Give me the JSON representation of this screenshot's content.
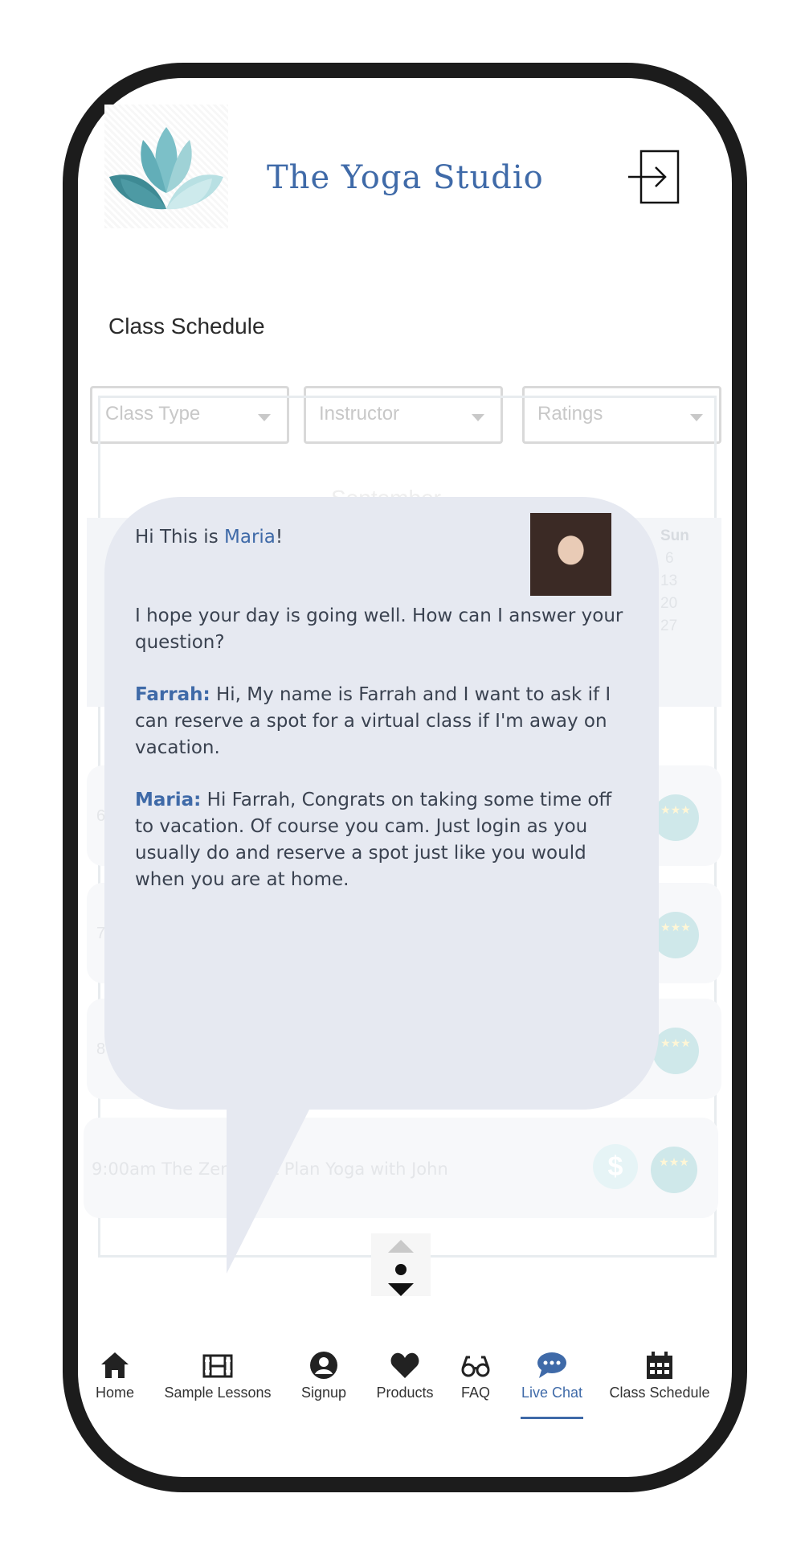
{
  "app": {
    "title": "The Yoga Studio"
  },
  "header": {
    "login_icon": "login-arrow-icon",
    "logo_icon": "lotus-logo-icon"
  },
  "page": {
    "section_title": "Class Schedule"
  },
  "filters": [
    {
      "label": "Class Type"
    },
    {
      "label": "Instructor"
    },
    {
      "label": "Ratings"
    }
  ],
  "calendar": {
    "month": "September",
    "day_header": "Sun",
    "sun_dates": [
      "6",
      "13",
      "20",
      "27"
    ]
  },
  "schedule": {
    "last_class": "9:00am The Zen Plant Plan Yoga with John",
    "row_prefixes": [
      "6",
      "7",
      "8"
    ],
    "rating_stars": "★★★",
    "price_symbol": "$"
  },
  "chat": {
    "greeting_prefix": "Hi This is ",
    "greeting_name": "Maria",
    "greeting_suffix": "!",
    "intro": "I hope your day is going well. How can I answer your question?",
    "messages": [
      {
        "sender": "Farrah:",
        "text": " Hi, My name is Farrah and I want to ask if I can reserve a spot for a virtual class if I'm away on vacation."
      },
      {
        "sender": "Maria:",
        "text": " Hi Farrah, Congrats on taking some time off to vacation. Of course you cam. Just login as you usually do and reserve a spot just like you would when you are at home."
      }
    ]
  },
  "nav": [
    {
      "label": "Home",
      "icon": "home-icon"
    },
    {
      "label": "Sample Lessons",
      "icon": "film-icon"
    },
    {
      "label": "Signup",
      "icon": "user-circle-icon"
    },
    {
      "label": "Products",
      "icon": "heart-icon"
    },
    {
      "label": "FAQ",
      "icon": "glasses-icon"
    },
    {
      "label": "Live Chat",
      "icon": "chat-bubble-icon",
      "active": true
    },
    {
      "label": "Class Schedule",
      "icon": "calendar-icon"
    }
  ],
  "colors": {
    "accent": "#3f6aa8",
    "bubble": "#e6e9f1",
    "frame": "#1c1c1c"
  }
}
